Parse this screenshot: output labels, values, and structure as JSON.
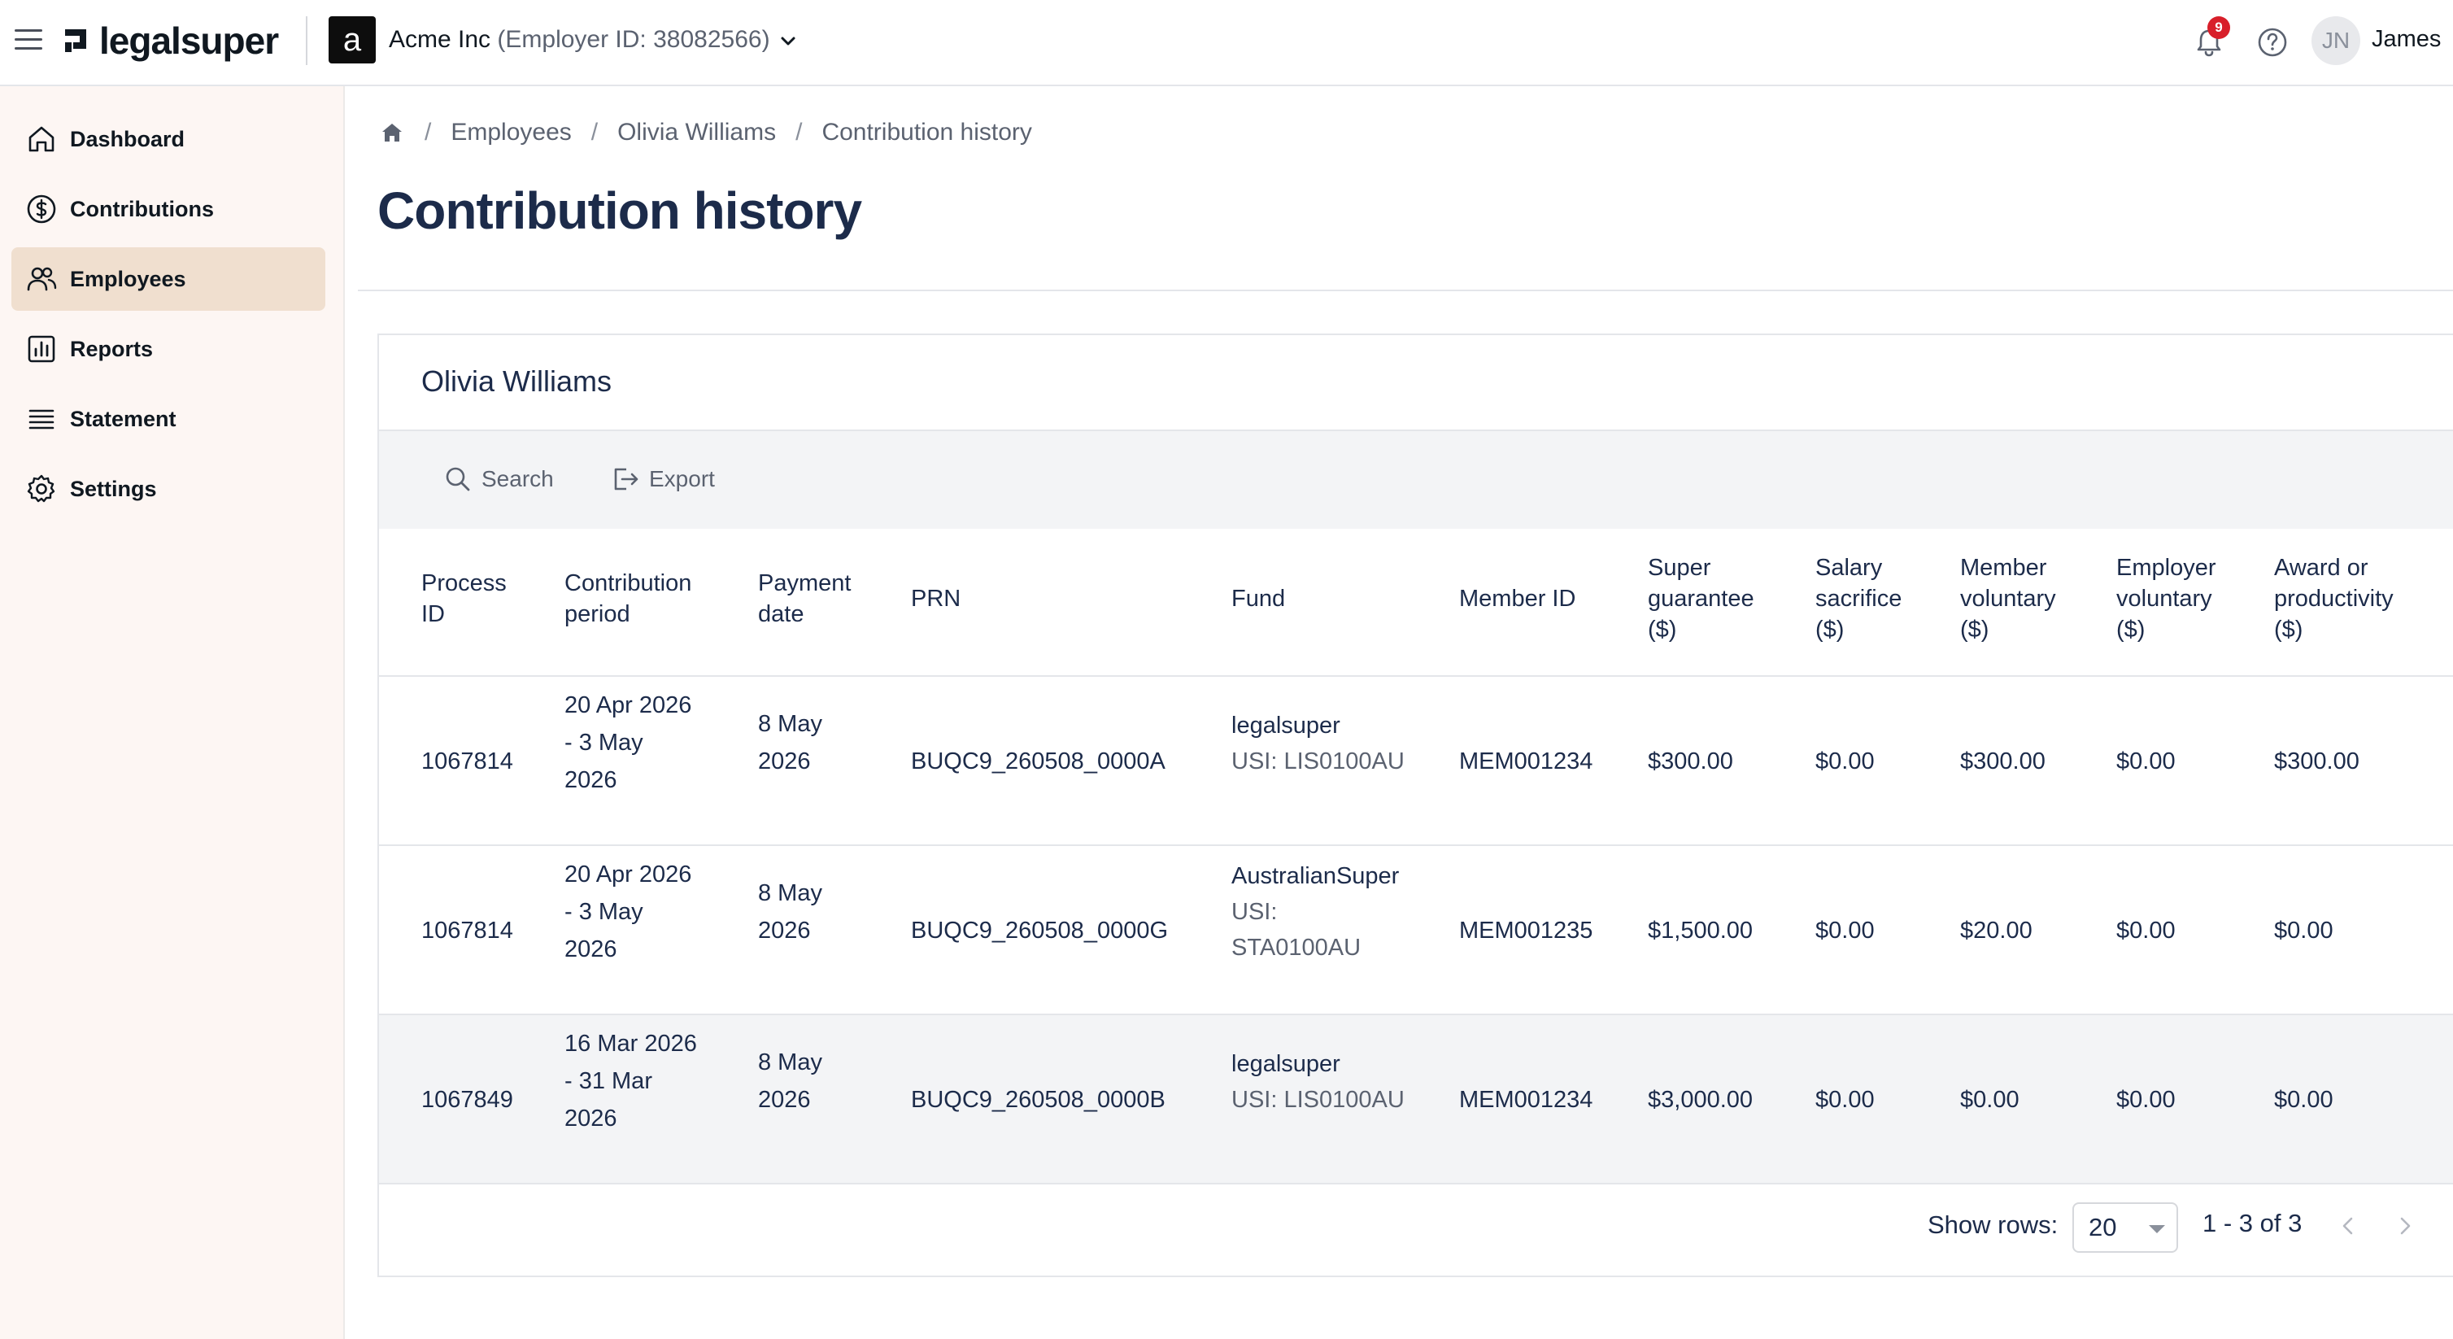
{
  "topbar": {
    "brand": "legalsuper",
    "org_initial": "a",
    "org_name": "Acme Inc",
    "org_id": "(Employer ID: 38082566)",
    "notification_count": "9",
    "user_initials": "JN",
    "user_name": "James"
  },
  "sidebar": {
    "items": [
      {
        "label": "Dashboard",
        "icon": "home-icon"
      },
      {
        "label": "Contributions",
        "icon": "dollar-circle-icon"
      },
      {
        "label": "Employees",
        "icon": "users-icon",
        "active": true
      },
      {
        "label": "Reports",
        "icon": "bar-chart-icon"
      },
      {
        "label": "Statement",
        "icon": "list-icon"
      },
      {
        "label": "Settings",
        "icon": "gear-icon"
      }
    ]
  },
  "breadcrumb": {
    "items": [
      "Employees",
      "Olivia Williams",
      "Contribution history"
    ],
    "separator": "/"
  },
  "page": {
    "title": "Contribution history"
  },
  "card": {
    "employee_name": "Olivia Williams",
    "toolbar": {
      "search_label": "Search",
      "export_label": "Export"
    },
    "columns": [
      [
        "Process",
        "ID"
      ],
      [
        "Contribution",
        "period"
      ],
      [
        "Payment",
        "date"
      ],
      [
        "PRN"
      ],
      [
        "Fund"
      ],
      [
        "Member ID"
      ],
      [
        "Super",
        "guarantee",
        "($)"
      ],
      [
        "Salary",
        "sacrifice",
        "($)"
      ],
      [
        "Member",
        "voluntary",
        "($)"
      ],
      [
        "Employer",
        "voluntary",
        "($)"
      ],
      [
        "Award or",
        "productivity",
        "($)"
      ]
    ],
    "rows": [
      {
        "process_id": "1067814",
        "period": [
          "20 Apr 2026",
          "- 3 May",
          "2026"
        ],
        "payment_date": [
          "8 May",
          "2026"
        ],
        "prn": "BUQC9_260508_0000A",
        "fund": [
          "legalsuper",
          "USI: LIS0100AU"
        ],
        "member_id": "MEM001234",
        "super_guarantee": "$300.00",
        "salary_sacrifice": "$0.00",
        "member_voluntary": "$300.00",
        "employer_voluntary": "$0.00",
        "award": "$300.00"
      },
      {
        "process_id": "1067814",
        "period": [
          "20 Apr 2026",
          "- 3 May",
          "2026"
        ],
        "payment_date": [
          "8 May",
          "2026"
        ],
        "prn": "BUQC9_260508_0000G",
        "fund": [
          "AustralianSuper",
          "USI:",
          "STA0100AU"
        ],
        "member_id": "MEM001235",
        "super_guarantee": "$1,500.00",
        "salary_sacrifice": "$0.00",
        "member_voluntary": "$20.00",
        "employer_voluntary": "$0.00",
        "award": "$0.00"
      },
      {
        "process_id": "1067849",
        "period": [
          "16 Mar 2026",
          "- 31 Mar",
          "2026"
        ],
        "payment_date": [
          "8 May",
          "2026"
        ],
        "prn": "BUQC9_260508_0000B",
        "fund": [
          "legalsuper",
          "USI: LIS0100AU"
        ],
        "member_id": "MEM001234",
        "super_guarantee": "$3,000.00",
        "salary_sacrifice": "$0.00",
        "member_voluntary": "$0.00",
        "employer_voluntary": "$0.00",
        "award": "$0.00"
      }
    ],
    "footer": {
      "show_rows_label": "Show rows:",
      "rows_value": "20",
      "range_text": "1 - 3 of 3"
    }
  },
  "colors": {
    "sidebar_bg": "#fdf6f3",
    "active_nav": "#f0dfcf",
    "title": "#1c2b4a",
    "badge": "#d81f2a",
    "toolbar_bg": "#f3f4f6"
  }
}
